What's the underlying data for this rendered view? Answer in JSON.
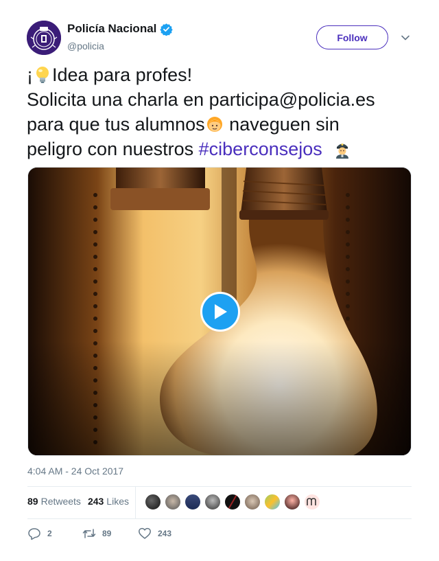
{
  "account": {
    "display_name": "Policía Nacional",
    "handle": "@policia",
    "verified": true
  },
  "header": {
    "follow_label": "Follow"
  },
  "tweet": {
    "line1_prefix": "¡",
    "line1_text": "Idea para profes!",
    "line2": "Solicita una charla en participa@policia.es",
    "line3_a": "para que tus alumnos",
    "line3_b": " naveguen sin",
    "line4_a": "peligro con nuestros ",
    "hashtag": "#ciberconsejos",
    "emojis": [
      "light-bulb-emoji",
      "child-emoji",
      "police-officer-emoji"
    ]
  },
  "media": {
    "type": "video",
    "play_icon": "play-icon"
  },
  "timestamp": "4:04 AM - 24 Oct 2017",
  "stats": {
    "retweets_count": "89",
    "retweets_label": "Retweets",
    "likes_count": "243",
    "likes_label": "Likes"
  },
  "likers_count": 9,
  "actions": {
    "reply_count": "2",
    "retweet_count": "89",
    "like_count": "243"
  },
  "colors": {
    "accent": "#4a2fbd",
    "play": "#1da1f2",
    "verified": "#1da1f2",
    "muted": "#657786"
  }
}
